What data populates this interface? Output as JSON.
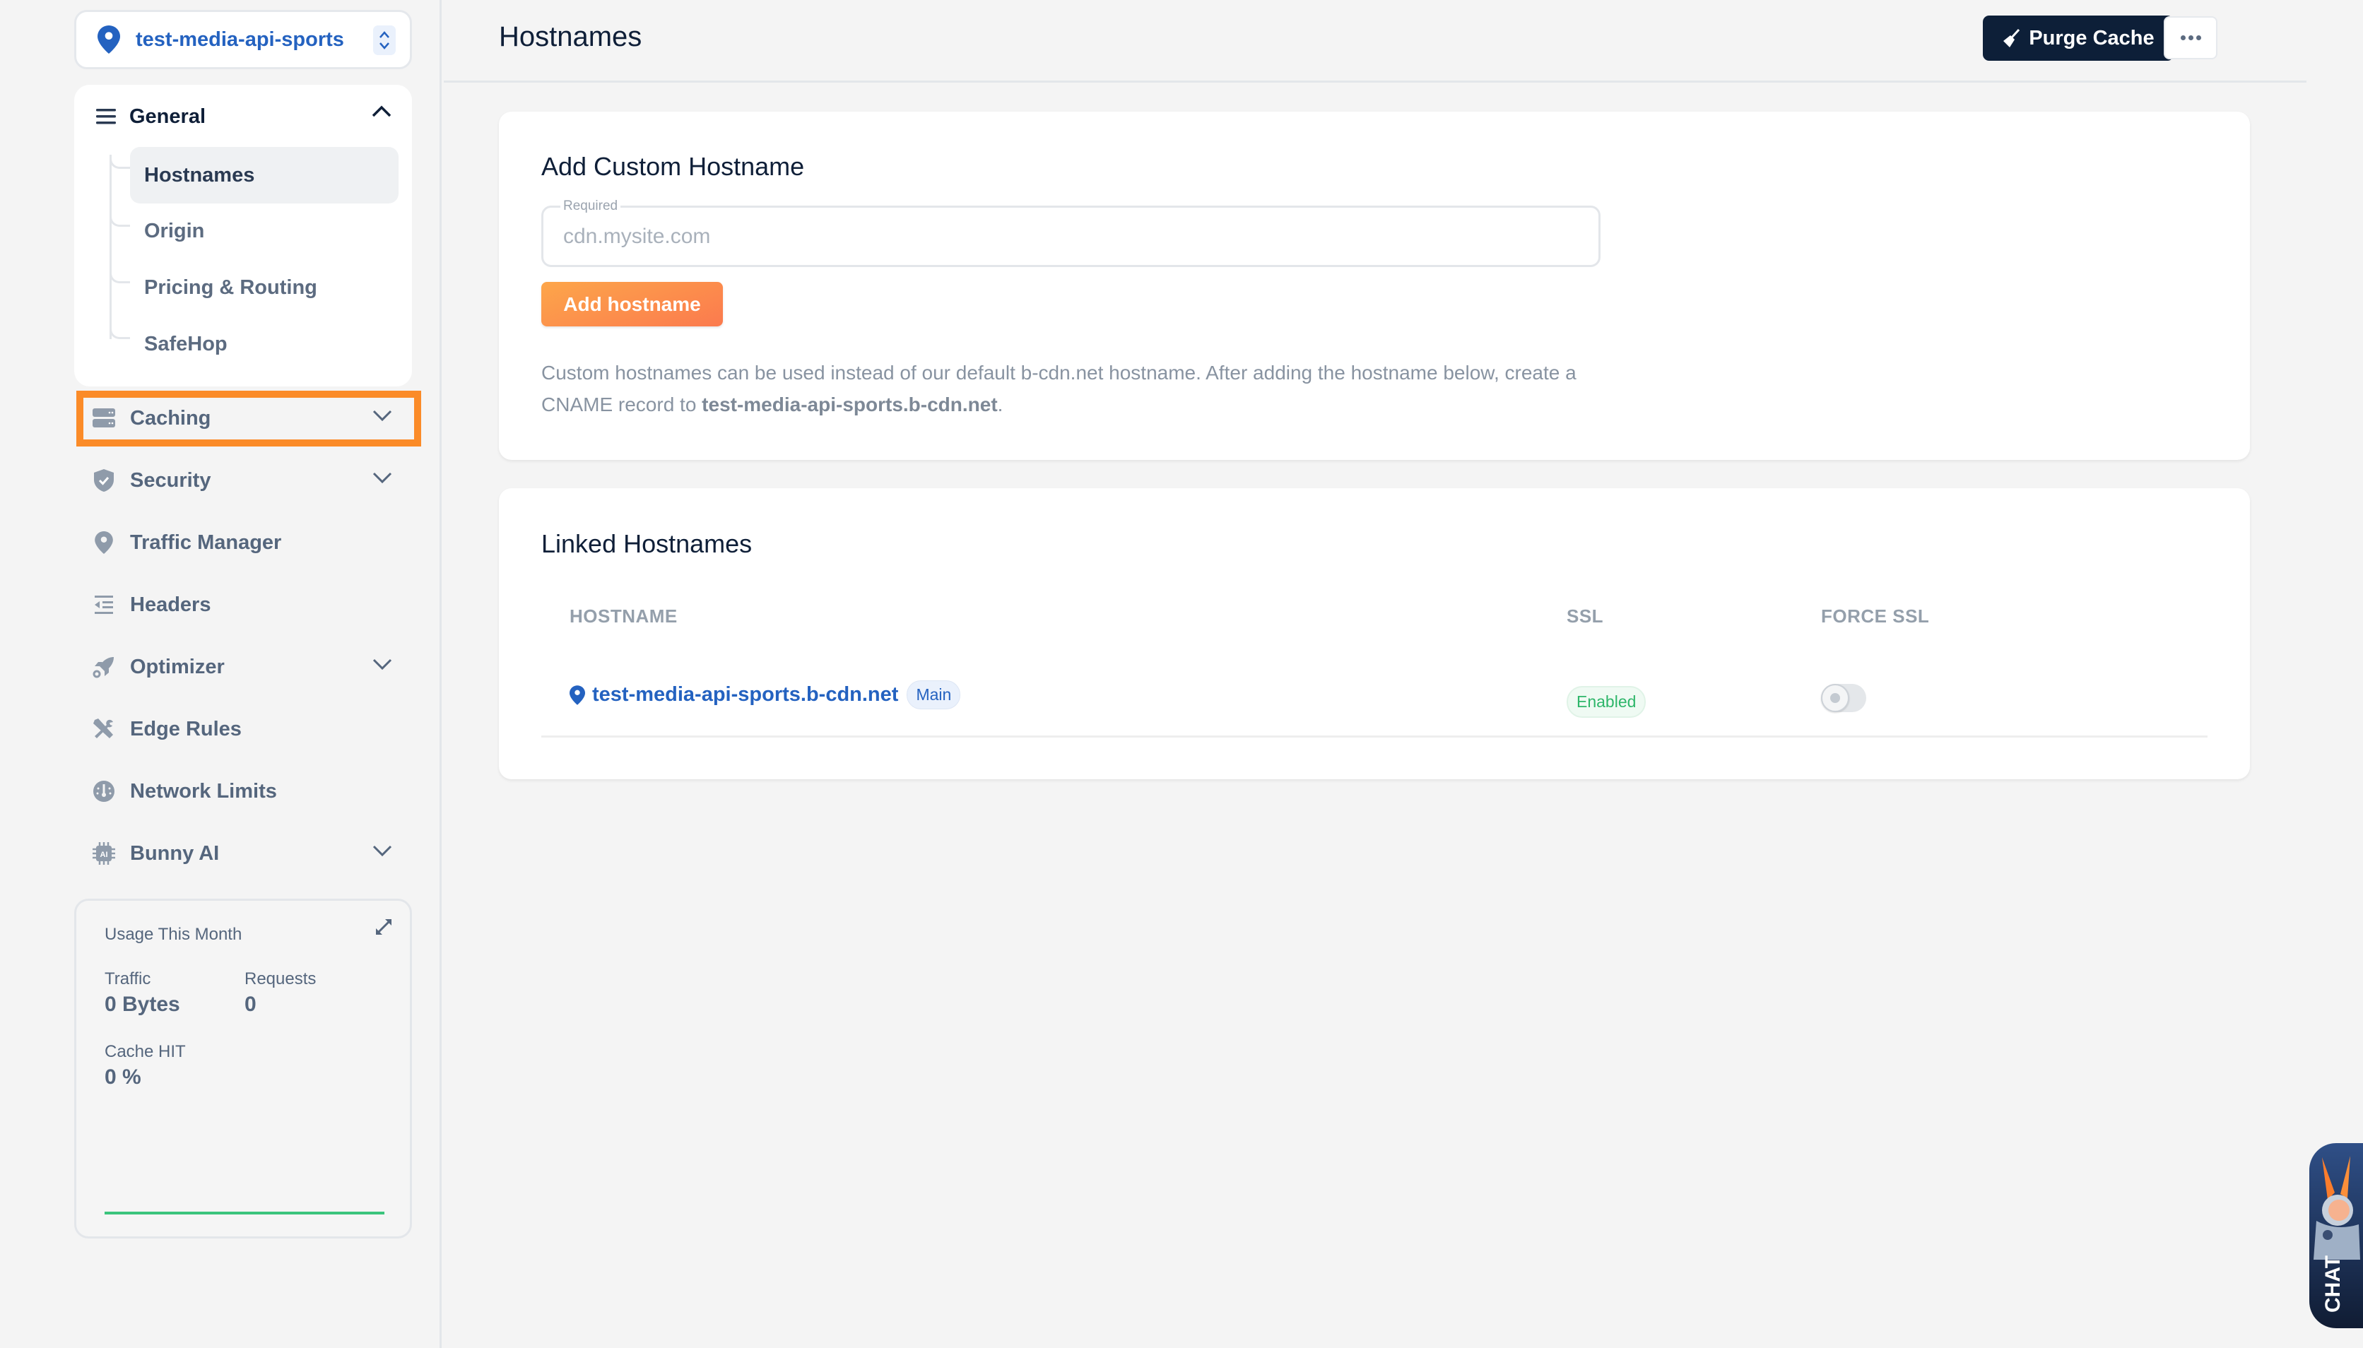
{
  "sidebar": {
    "zone_name": "test-media-api-sports",
    "general": {
      "label": "General",
      "items": [
        {
          "label": "Hostnames",
          "active": true
        },
        {
          "label": "Origin"
        },
        {
          "label": "Pricing & Routing"
        },
        {
          "label": "SafeHop"
        }
      ]
    },
    "nav": [
      {
        "label": "Caching",
        "icon": "server-icon",
        "expandable": true,
        "highlighted": true
      },
      {
        "label": "Security",
        "icon": "shield-check-icon",
        "expandable": true
      },
      {
        "label": "Traffic Manager",
        "icon": "map-pin-icon",
        "expandable": false
      },
      {
        "label": "Headers",
        "icon": "headers-list-icon",
        "expandable": false
      },
      {
        "label": "Optimizer",
        "icon": "rocket-icon",
        "expandable": true
      },
      {
        "label": "Edge Rules",
        "icon": "tools-icon",
        "expandable": false
      },
      {
        "label": "Network Limits",
        "icon": "gauge-icon",
        "expandable": false
      },
      {
        "label": "Bunny AI",
        "icon": "ai-chip-icon",
        "expandable": true
      }
    ],
    "usage": {
      "title": "Usage This Month",
      "traffic_label": "Traffic",
      "traffic_value": "0 Bytes",
      "requests_label": "Requests",
      "requests_value": "0",
      "cache_hit_label": "Cache HIT",
      "cache_hit_value": "0 %"
    }
  },
  "header": {
    "title": "Hostnames",
    "purge_label": "Purge Cache"
  },
  "add_card": {
    "title": "Add Custom Hostname",
    "field_legend": "Required",
    "field_placeholder": "cdn.mysite.com",
    "field_value": "",
    "button_label": "Add hostname",
    "help_text": "Custom hostnames can be used instead of our default b-cdn.net hostname. After adding the hostname below, create a CNAME record to ",
    "help_target": "test-media-api-sports.b-cdn.net",
    "help_end": "."
  },
  "linked_card": {
    "title": "Linked Hostnames",
    "columns": [
      "HOSTNAME",
      "SSL",
      "FORCE SSL"
    ],
    "rows": [
      {
        "hostname": "test-media-api-sports.b-cdn.net",
        "badge": "Main",
        "ssl": "Enabled",
        "force_ssl": false
      }
    ]
  },
  "chat": {
    "label": "CHAT"
  },
  "colors": {
    "accent_blue": "#2462c0",
    "navy": "#0d1f38",
    "orange_highlight": "#fb8b28",
    "success_green": "#2eb66a"
  }
}
